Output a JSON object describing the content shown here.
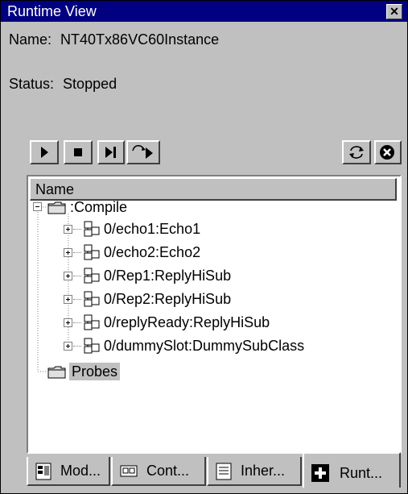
{
  "window": {
    "title": "Runtime View"
  },
  "info": {
    "name_label": "Name:",
    "name_value": "NT40Tx86VC60Instance",
    "status_label": "Status:",
    "status_value": "Stopped"
  },
  "tree": {
    "column_header": "Name",
    "root": {
      "label": ":Compile",
      "expanded": true
    },
    "children": [
      "0/echo1:Echo1",
      "0/echo2:Echo2",
      "0/Rep1:ReplyHiSub",
      "0/Rep2:ReplyHiSub",
      "0/replyReady:ReplyHiSub",
      "0/dummySlot:DummySubClass"
    ],
    "probes": {
      "label": "Probes",
      "selected": true
    }
  },
  "tabs": [
    {
      "label": "Mod...",
      "icon": "module-icon",
      "active": false
    },
    {
      "label": "Cont...",
      "icon": "container-icon",
      "active": false
    },
    {
      "label": "Inher...",
      "icon": "inheritance-icon",
      "active": false
    },
    {
      "label": "Runt...",
      "icon": "runtime-icon",
      "active": true
    }
  ]
}
